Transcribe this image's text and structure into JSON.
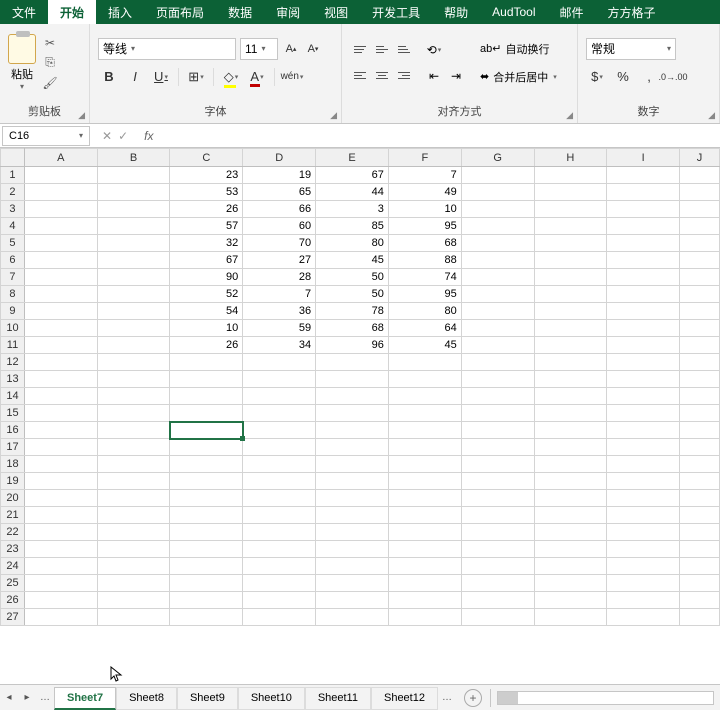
{
  "tabs": {
    "file": "文件",
    "home": "开始",
    "insert": "插入",
    "layout": "页面布局",
    "data": "数据",
    "review": "审阅",
    "view": "视图",
    "dev": "开发工具",
    "help": "帮助",
    "aud": "AudTool",
    "mail": "邮件",
    "ffgz": "方方格子"
  },
  "ribbon": {
    "clipboard": {
      "label": "剪贴板",
      "paste": "粘贴"
    },
    "font": {
      "label": "字体",
      "name": "等线",
      "size": "11",
      "bold": "B",
      "italic": "I",
      "underline": "U",
      "wen": "wén"
    },
    "align": {
      "label": "对齐方式",
      "wrap": "自动换行",
      "merge": "合并后居中"
    },
    "number": {
      "label": "数字",
      "format": "常规"
    }
  },
  "fbar": {
    "cell": "C16",
    "fx": "fx"
  },
  "grid": {
    "columns": [
      "A",
      "B",
      "C",
      "D",
      "E",
      "F",
      "G",
      "H",
      "I",
      "J"
    ],
    "rows": 27,
    "active": "C16",
    "data": {
      "1": {
        "C": 23,
        "D": 19,
        "E": 67,
        "F": 7
      },
      "2": {
        "C": 53,
        "D": 65,
        "E": 44,
        "F": 49
      },
      "3": {
        "C": 26,
        "D": 66,
        "E": 3,
        "F": 10
      },
      "4": {
        "C": 57,
        "D": 60,
        "E": 85,
        "F": 95
      },
      "5": {
        "C": 32,
        "D": 70,
        "E": 80,
        "F": 68
      },
      "6": {
        "C": 67,
        "D": 27,
        "E": 45,
        "F": 88
      },
      "7": {
        "C": 90,
        "D": 28,
        "E": 50,
        "F": 74
      },
      "8": {
        "C": 52,
        "D": 7,
        "E": 50,
        "F": 95
      },
      "9": {
        "C": 54,
        "D": 36,
        "E": 78,
        "F": 80
      },
      "10": {
        "C": 10,
        "D": 59,
        "E": 68,
        "F": 64
      },
      "11": {
        "C": 26,
        "D": 34,
        "E": 96,
        "F": 45
      }
    }
  },
  "sheets": {
    "active": "Sheet7",
    "list": [
      "Sheet7",
      "Sheet8",
      "Sheet9",
      "Sheet10",
      "Sheet11",
      "Sheet12"
    ]
  }
}
